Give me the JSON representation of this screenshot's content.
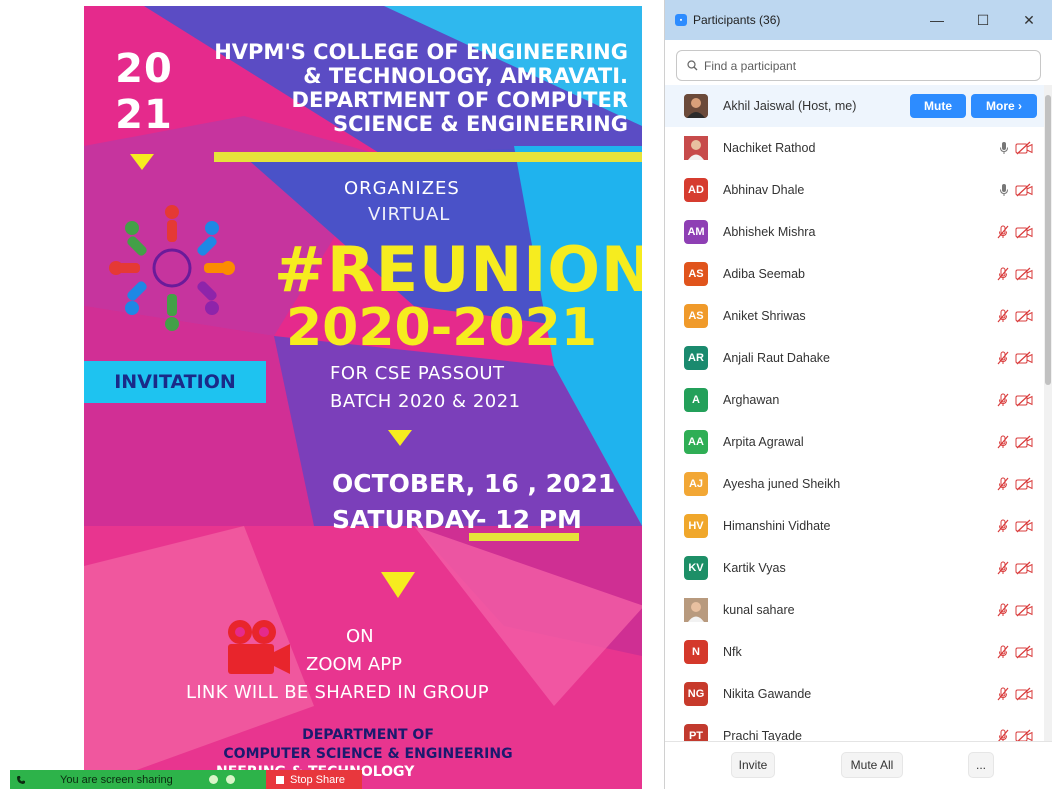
{
  "poster": {
    "year_top": "20",
    "year_bottom": "21",
    "college_lines": [
      "HVPM'S COLLEGE OF ENGINEERING",
      "& TECHNOLOGY, AMRAVATI.",
      "DEPARTMENT OF COMPUTER",
      "SCIENCE & ENGINEERING"
    ],
    "organizes": "ORGANIZES",
    "virtual": "VIRTUAL",
    "reunion": "#REUNION",
    "years": "2020-2021",
    "cse_line1": "FOR CSE PASSOUT",
    "cse_line2": "BATCH 2020 & 2021",
    "invitation": "INVITATION",
    "date_line1": "OCTOBER, 16 , 2021",
    "date_line2": "SATURDAY- 12 PM",
    "on": "ON",
    "zoom_app": "ZOOM APP",
    "link_note": "LINK WILL BE SHARED IN GROUP",
    "dept_line1": "DEPARTMENT OF",
    "dept_line2": "COMPUTER SCIENCE & ENGINEERING",
    "college_footer": "NEERING & TECHNOLOGY"
  },
  "sharebar": {
    "status": "You are screen sharing",
    "stop_label": "Stop Share"
  },
  "panel": {
    "title": "Participants (36)",
    "search_placeholder": "Find a participant",
    "host_name": "Akhil Jaiswal (Host, me)",
    "mute_label": "Mute",
    "more_label": "More ›",
    "footer": {
      "invite": "Invite",
      "mute_all": "Mute All",
      "more": "..."
    },
    "participants": [
      {
        "initials": "",
        "name": "Nachiket Rathod",
        "color": "#c74b4b",
        "photo": true,
        "mic": "on"
      },
      {
        "initials": "AD",
        "name": "Abhinav Dhale",
        "color": "#d63c2f",
        "photo": false,
        "mic": "on"
      },
      {
        "initials": "AM",
        "name": "Abhishek Mishra",
        "color": "#8e3fb4",
        "photo": false,
        "mic": "muted"
      },
      {
        "initials": "AS",
        "name": "Adiba Seemab",
        "color": "#e0541c",
        "photo": false,
        "mic": "muted"
      },
      {
        "initials": "AS",
        "name": "Aniket Shriwas",
        "color": "#f09a2a",
        "photo": false,
        "mic": "muted"
      },
      {
        "initials": "AR",
        "name": "Anjali Raut Dahake",
        "color": "#1a8a6e",
        "photo": false,
        "mic": "muted"
      },
      {
        "initials": "A",
        "name": "Arghawan",
        "color": "#23a05a",
        "photo": false,
        "mic": "muted"
      },
      {
        "initials": "AA",
        "name": "Arpita Agrawal",
        "color": "#2fae55",
        "photo": false,
        "mic": "muted"
      },
      {
        "initials": "AJ",
        "name": "Ayesha juned Sheikh",
        "color": "#f2a735",
        "photo": false,
        "mic": "muted"
      },
      {
        "initials": "HV",
        "name": "Himanshini Vidhate",
        "color": "#f0a72b",
        "photo": false,
        "mic": "muted"
      },
      {
        "initials": "KV",
        "name": "Kartik Vyas",
        "color": "#1d8f67",
        "photo": false,
        "mic": "muted"
      },
      {
        "initials": "",
        "name": "kunal sahare",
        "color": "#b89a7e",
        "photo": true,
        "mic": "muted"
      },
      {
        "initials": "N",
        "name": "Nfk",
        "color": "#d4392b",
        "photo": false,
        "mic": "muted"
      },
      {
        "initials": "NG",
        "name": "Nikita Gawande",
        "color": "#c73a2b",
        "photo": false,
        "mic": "muted"
      },
      {
        "initials": "PT",
        "name": "Prachi Tayade",
        "color": "#c23a2e",
        "photo": false,
        "mic": "muted"
      }
    ]
  }
}
